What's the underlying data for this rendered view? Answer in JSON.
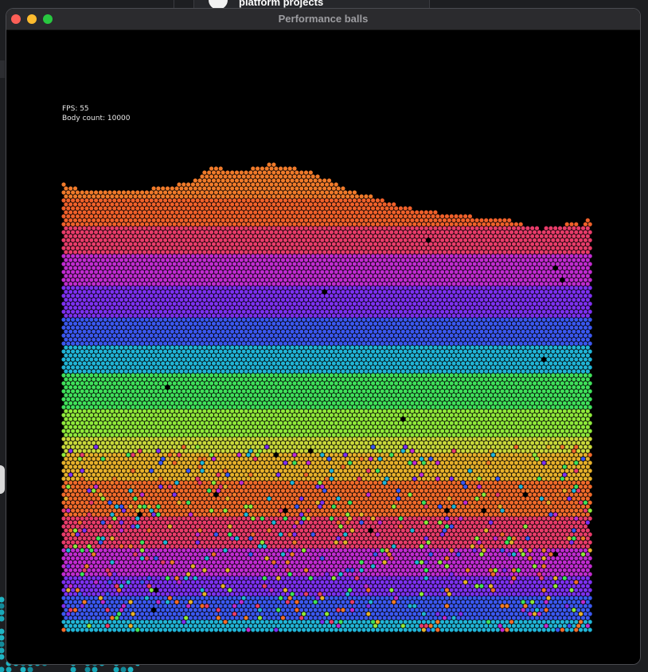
{
  "background": {
    "project_title": "platform projects"
  },
  "window": {
    "title": "Performance balls",
    "controls": [
      "close-icon",
      "minimize-icon",
      "zoom-icon"
    ]
  },
  "hud": {
    "fps_label": "FPS: 55",
    "body_count_label": "Body count: 10000"
  },
  "simulation": {
    "fps": 55,
    "body_count": 10000,
    "palette": [
      "#f07a2a",
      "#e83b6a",
      "#c02ad0",
      "#7d2ff0",
      "#3a57f0",
      "#20b4d6",
      "#3fe05a",
      "#8ee83a",
      "#e6b02a",
      "#f06a2a"
    ]
  },
  "colors": {
    "close": "#fe5f57",
    "minimize": "#febc2e",
    "zoom": "#28c840",
    "canvas_bg": "#000000"
  }
}
